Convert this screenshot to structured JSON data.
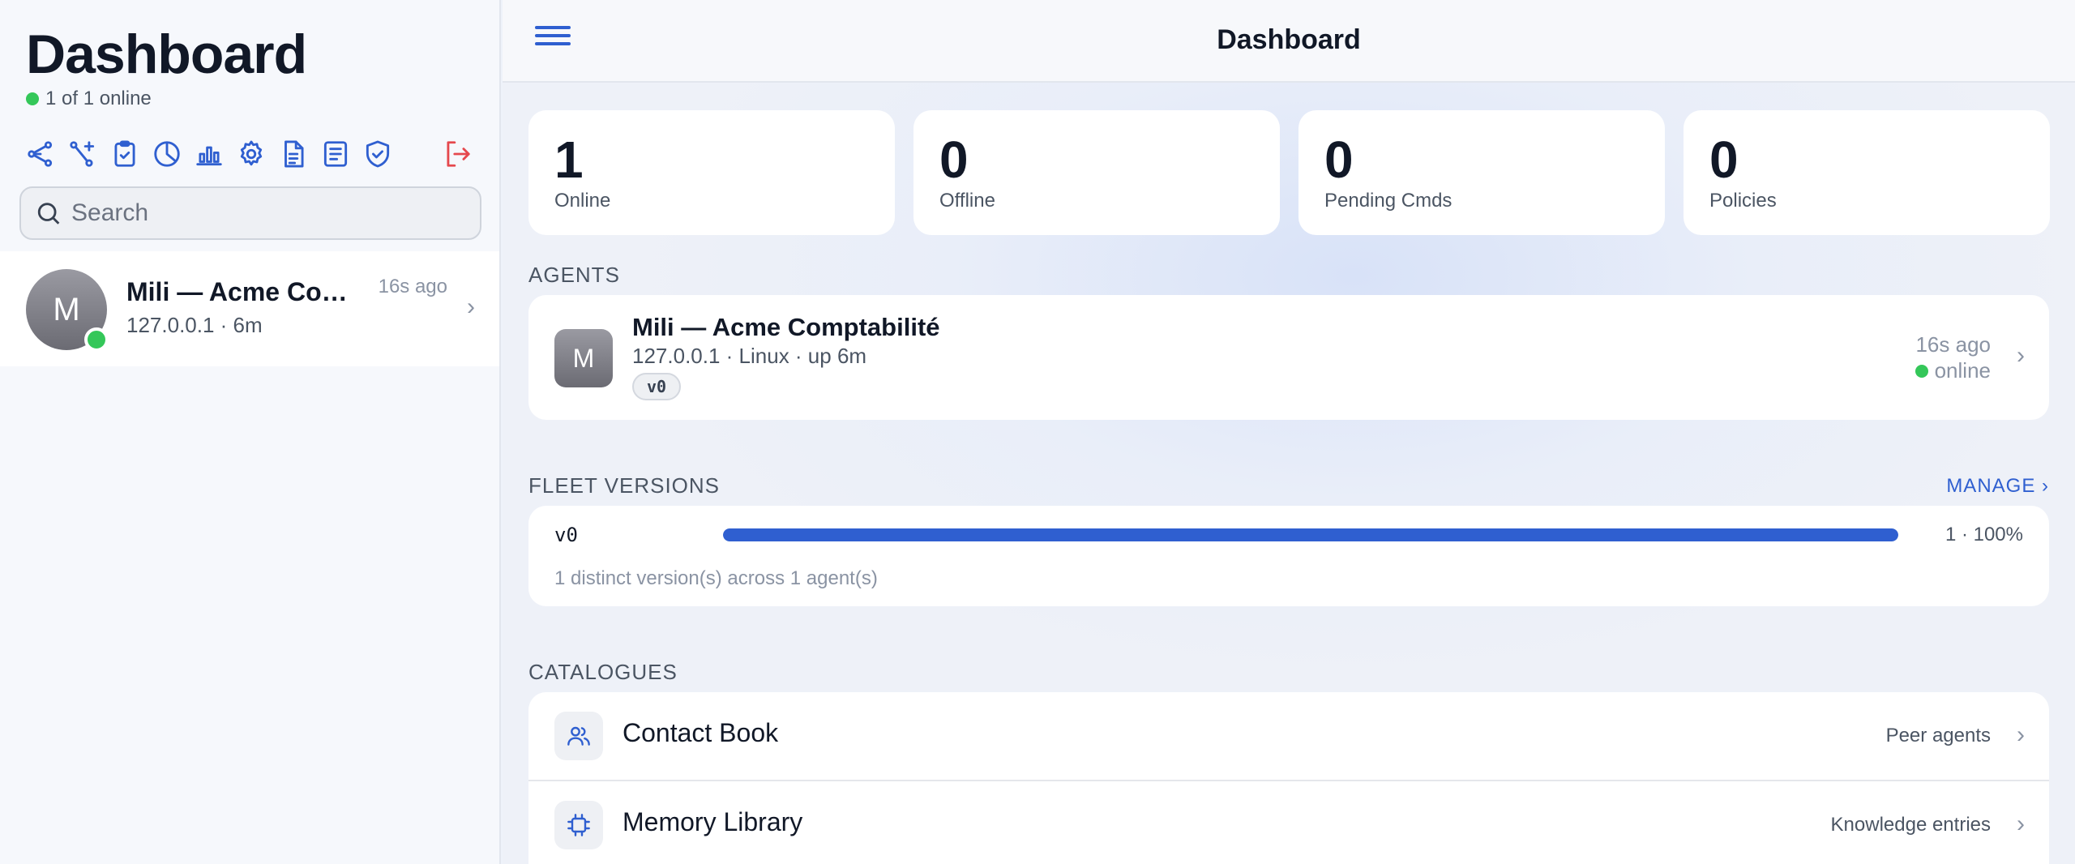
{
  "sidebar": {
    "title": "Dashboard",
    "status_text": "1 of 1 online",
    "search_placeholder": "Search",
    "toolbar_icons": [
      "share-nodes-icon",
      "magic-wand-icon",
      "clipboard-check-icon",
      "pie-chart-icon",
      "bar-chart-icon",
      "gear-icon",
      "document-icon",
      "list-icon",
      "shield-check-icon",
      "logout-icon"
    ],
    "agent": {
      "avatar_letter": "M",
      "name": "Mili — Acme Comptabilité",
      "subtitle": "127.0.0.1 · 6m",
      "time": "16s ago",
      "chevron": "›"
    }
  },
  "topbar": {
    "title": "Dashboard",
    "menu_icon": "hamburger-icon"
  },
  "stats": [
    {
      "value": "1",
      "label": "Online"
    },
    {
      "value": "0",
      "label": "Offline"
    },
    {
      "value": "0",
      "label": "Pending Cmds"
    },
    {
      "value": "0",
      "label": "Policies"
    }
  ],
  "agents_section": {
    "label": "AGENTS",
    "agent": {
      "avatar_letter": "M",
      "name": "Mili — Acme Comptabilité",
      "subtitle": "127.0.0.1 · Linux · up 6m",
      "version_badge": "v0",
      "time": "16s ago",
      "status": "online",
      "chevron": "›"
    }
  },
  "fleet_section": {
    "label": "FLEET VERSIONS",
    "manage_link": "MANAGE ›",
    "versions": [
      {
        "name": "v0",
        "count_text": "1 · 100%",
        "fraction": 1.0
      }
    ],
    "summary": "1 distinct version(s) across 1 agent(s)"
  },
  "catalogues_section": {
    "label": "CATALOGUES",
    "items": [
      {
        "title": "Contact Book",
        "meta": "Peer agents",
        "icon": "people-icon",
        "chevron": "›"
      },
      {
        "title": "Memory Library",
        "meta": "Knowledge entries",
        "icon": "chip-icon",
        "chevron": "›"
      }
    ]
  },
  "colors": {
    "accent": "#2f5fd0",
    "online": "#34c759",
    "logout": "#e5484d"
  }
}
